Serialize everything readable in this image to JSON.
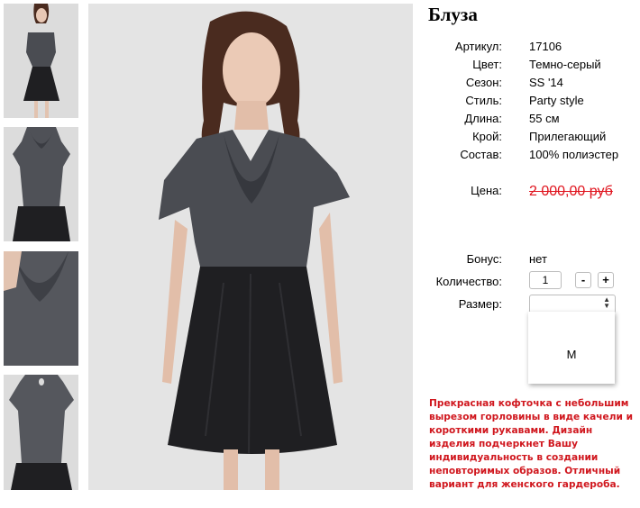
{
  "product": {
    "title": "Блуза",
    "attributes": [
      {
        "label": "Артикул:",
        "value": "17106"
      },
      {
        "label": "Цвет:",
        "value": "Темно-серый"
      },
      {
        "label": "Сезон:",
        "value": "SS '14"
      },
      {
        "label": "Стиль:",
        "value": "Party style"
      },
      {
        "label": "Длина:",
        "value": "55 см"
      },
      {
        "label": "Крой:",
        "value": "Прилегающий"
      },
      {
        "label": "Состав:",
        "value": "100% полиэстер"
      }
    ],
    "price_label": "Цена:",
    "price_value": "2 000,00 руб",
    "bonus_label": "Бонус:",
    "bonus_value": "нет",
    "quantity_label": "Количество:",
    "quantity_value": "1",
    "minus_label": "-",
    "plus_label": "+",
    "size_label": "Размер:",
    "size_option": "M",
    "description": "Прекрасная кофточка с небольшим вырезом горловины в виде качели и короткими рукавами. Дизайн изделия подчеркнет Вашу индивидуальность в создании неповторимых образов. Отличный вариант для женского гардероба."
  },
  "colors": {
    "price": "#e0141e",
    "description": "#d0171e",
    "blouse": "#4a4c52",
    "skirt": "#1f1f22"
  },
  "icons": {
    "select_arrows": "up-down-chevron-icon"
  }
}
